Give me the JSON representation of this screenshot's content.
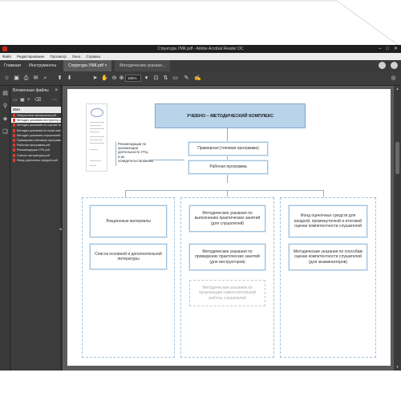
{
  "window": {
    "title": "Структура УМК.pdf - Adobe Acrobat Reader DC",
    "controls": [
      "–",
      "□",
      "✕"
    ]
  },
  "menu": [
    "Файл",
    "Редактирование",
    "Просмотр",
    "Окно",
    "Справка"
  ],
  "nav_tabs": [
    "Главная",
    "Инструменты"
  ],
  "doc_tabs": [
    {
      "label": "Структура УМК.pdf",
      "close": "×",
      "active": true
    },
    {
      "label": "Методические указани...",
      "close": "",
      "active": false
    }
  ],
  "toolbar": {
    "zoom_value": "106%"
  },
  "attachments_panel": {
    "title": "Вложенные файлы",
    "close": "×",
    "column_header": "Имя",
    "files": [
      "Лекционные материалы.pdf",
      "Методич.указания инструктор.pdf",
      "Методич.указания по оценке компет.pdf",
      "Методич.указания по практ.занятиям.pdf",
      "Методич.указания слушателей.pdf",
      "Примерная (типовая) программа.pdf",
      "Рабочая программа.pdf",
      "Рекомендации ОТК.pdf",
      "Список литературы.pdf",
      "Фонд оценочных средств.pdf"
    ],
    "selected_index": 1
  },
  "document": {
    "note_text": "Рекомендации по организации деятельности УТЦ и их освидетельствованию",
    "header": "УЧЕБНО – МЕТОДИЧЕСКИЙ КОМПЛЕКС",
    "level1": "Примерная (типовая программа)",
    "level2": "Рабочая программа",
    "col1": [
      "Лекционные материалы",
      "Список основной и дополнительной литературы"
    ],
    "col2": [
      "Методические указания по выполнению практических занятий (для слушателей)",
      "Методические указания по проведению практических занятий (для инструкторов)",
      "Методические указания по организации самостоятельной работы слушателей"
    ],
    "col3": [
      "Фонд оценочных средств для входной, промежуточной и итоговой оценки компетентности слушателей",
      "Методические указания по способам оценки компетентности слушателей (для экзаменаторов)"
    ]
  }
}
